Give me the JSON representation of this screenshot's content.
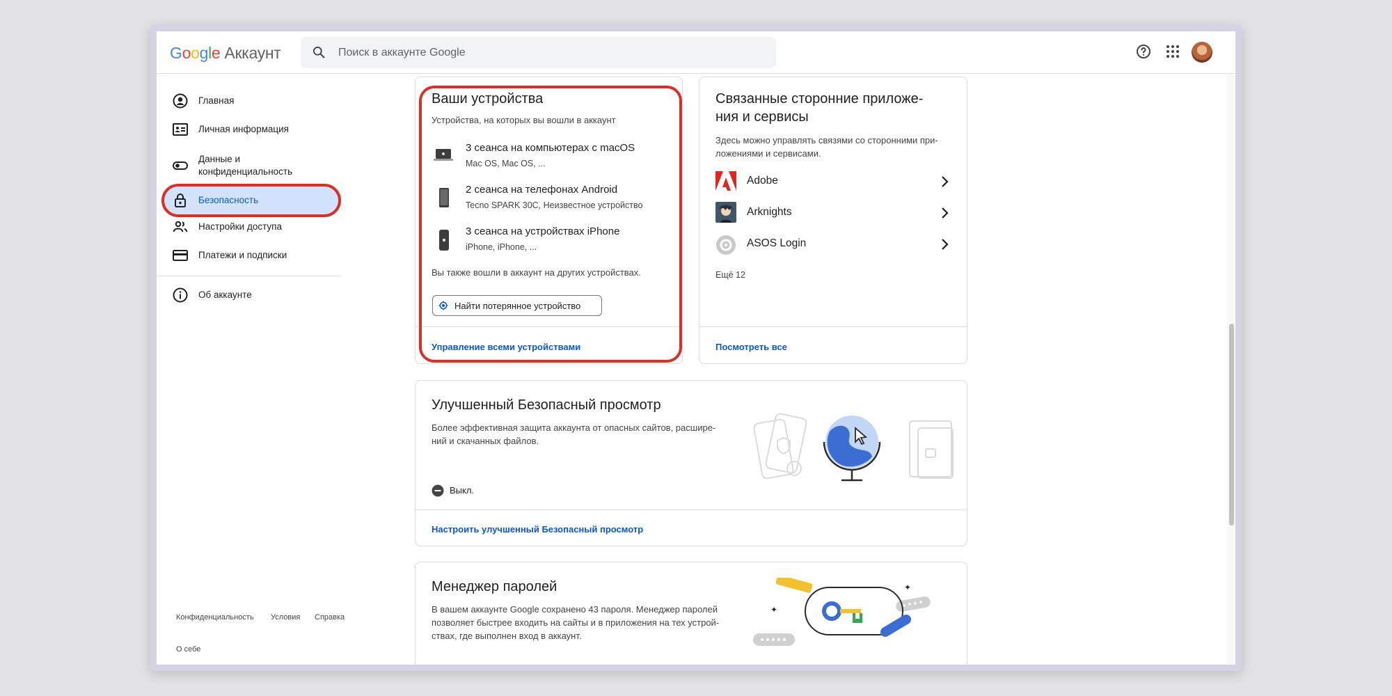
{
  "header": {
    "logo": [
      "G",
      "o",
      "o",
      "g",
      "l",
      "e"
    ],
    "logo_suffix": "Аккаунт",
    "search_placeholder": "Поиск в аккаунте Google",
    "icons": [
      "help-icon",
      "apps-grid-icon"
    ]
  },
  "sidebar": {
    "items": [
      {
        "label": "Главная",
        "icon": "home-user-icon"
      },
      {
        "label": "Личная информация",
        "icon": "id-card-icon"
      },
      {
        "label": "Данные и конфиденциальность",
        "icon": "toggle-icon"
      },
      {
        "label": "Безопасность",
        "icon": "lock-icon",
        "active": true
      },
      {
        "label": "Настройки доступа",
        "icon": "people-icon"
      },
      {
        "label": "Платежи и подписки",
        "icon": "card-icon"
      },
      {
        "label": "Об аккаунте",
        "icon": "info-icon"
      }
    ],
    "footer": {
      "privacy": "Конфиденциальность",
      "terms": "Условия",
      "help": "Справка",
      "about": "О себе"
    }
  },
  "devices_card": {
    "title": "Ваши устройства",
    "subtitle": "Устройства, на которых вы вошли в аккаунт",
    "devices": [
      {
        "title": "3 сеанса на компьютерах с macOS",
        "sub": "Mac OS, Mac OS, ...",
        "icon": "laptop-icon"
      },
      {
        "title": "2 сеанса на телефонах Android",
        "sub": "Tecno SPARK 30C, Неизвестное устройство",
        "icon": "android-phone-icon"
      },
      {
        "title": "3 сеанса на устройствах iPhone",
        "sub": "iPhone, iPhone, ...",
        "icon": "iphone-icon"
      }
    ],
    "other_note": "Вы также вошли в аккаунт на других устройствах.",
    "find_button": "Найти потерянное устройство",
    "footer_link": "Управление всеми устройствами"
  },
  "apps_card": {
    "title_line1": "Связанные сторонние приложе-",
    "title_line2": "ния и сервисы",
    "desc_line1": "Здесь можно управлять связями со сторонними при-",
    "desc_line2": "ложениями и сервисами.",
    "apps": [
      {
        "name": "Adobe",
        "icon": "adobe-icon"
      },
      {
        "name": "Arknights",
        "icon": "arknights-icon"
      },
      {
        "name": "ASOS Login",
        "icon": "asos-icon"
      }
    ],
    "more": "Ещё 12",
    "footer_link": "Посмотреть все"
  },
  "safe_browsing_card": {
    "title": "Улучшенный Безопасный просмотр",
    "desc_line1": "Более эффективная защита аккаунта от опасных сайтов, расшире-",
    "desc_line2": "ний и скачанных файлов.",
    "status": "Выкл.",
    "footer_link": "Настроить улучшенный Безопасный просмотр"
  },
  "password_card": {
    "title": "Менеджер паролей",
    "desc_line1": "В вашем аккаунте Google сохранено 43 пароля. Менеджер паролей",
    "desc_line2": "позволяет быстрее входить на сайты и в приложения на тех устрой-",
    "desc_line3": "ствах, где выполнен вход в аккаунт."
  },
  "colors": {
    "accent": "#0b57d0",
    "active_bg": "#d3e3fd",
    "highlight": "#d93025"
  }
}
